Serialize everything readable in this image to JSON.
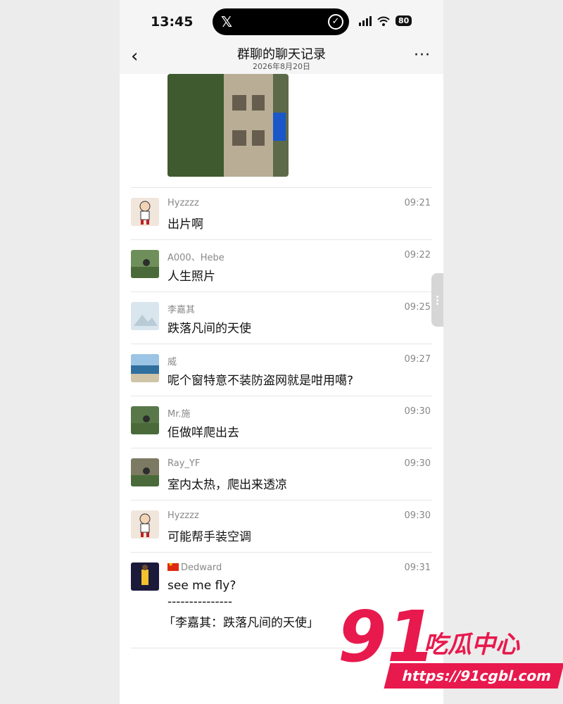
{
  "status_bar": {
    "time": "13:45",
    "battery": "80"
  },
  "dynamic_island": {
    "app_glyph": "𝕏",
    "check": "✓"
  },
  "nav": {
    "back_glyph": "‹",
    "title": "群聊的聊天记录",
    "date": "2026年8月20日",
    "more_glyph": "···"
  },
  "messages": [
    {
      "name": "Hyzzzz",
      "time": "09:21",
      "text": "出片啊",
      "avatar": "cartoon-avatar",
      "avatar_color": "#f1e6dc"
    },
    {
      "name": "A000、Hebe",
      "time": "09:22",
      "text": "人生照片",
      "avatar": "person-field-avatar",
      "avatar_color": "#6f8f5a"
    },
    {
      "name": "李嘉其",
      "time": "09:25",
      "text": "跌落凡间的天使",
      "avatar": "mountain-avatar",
      "avatar_color": "#d9e6ee"
    },
    {
      "name": "威",
      "time": "09:27",
      "text": "呢个窗特意不装防盗网就是咁用噶?",
      "avatar": "sea-avatar",
      "avatar_color": "#6fa3c9"
    },
    {
      "name": "Mr.施",
      "time": "09:30",
      "text": "佢做咩爬出去",
      "avatar": "landscape-avatar",
      "avatar_color": "#58784a"
    },
    {
      "name": "Ray_YF",
      "time": "09:30",
      "text": "室内太热，爬出来透凉",
      "avatar": "street-avatar",
      "avatar_color": "#7c7a62"
    },
    {
      "name": "Hyzzzz",
      "time": "09:30",
      "text": "可能帮手装空调",
      "avatar": "cartoon-avatar",
      "avatar_color": "#f1e6dc"
    },
    {
      "name": "Dedward",
      "time": "09:31",
      "text": "see me fly?",
      "avatar": "basketball-avatar",
      "avatar_color": "#1b1a3a",
      "divider": "---------------",
      "quote": "「李嘉其：跌落凡间的天使」"
    }
  ],
  "watermark": {
    "number": "91",
    "name": "吃瓜中心",
    "url": "https://91cgbl.com"
  },
  "colors": {
    "accent": "#e8194d",
    "flag": "#de2910"
  }
}
